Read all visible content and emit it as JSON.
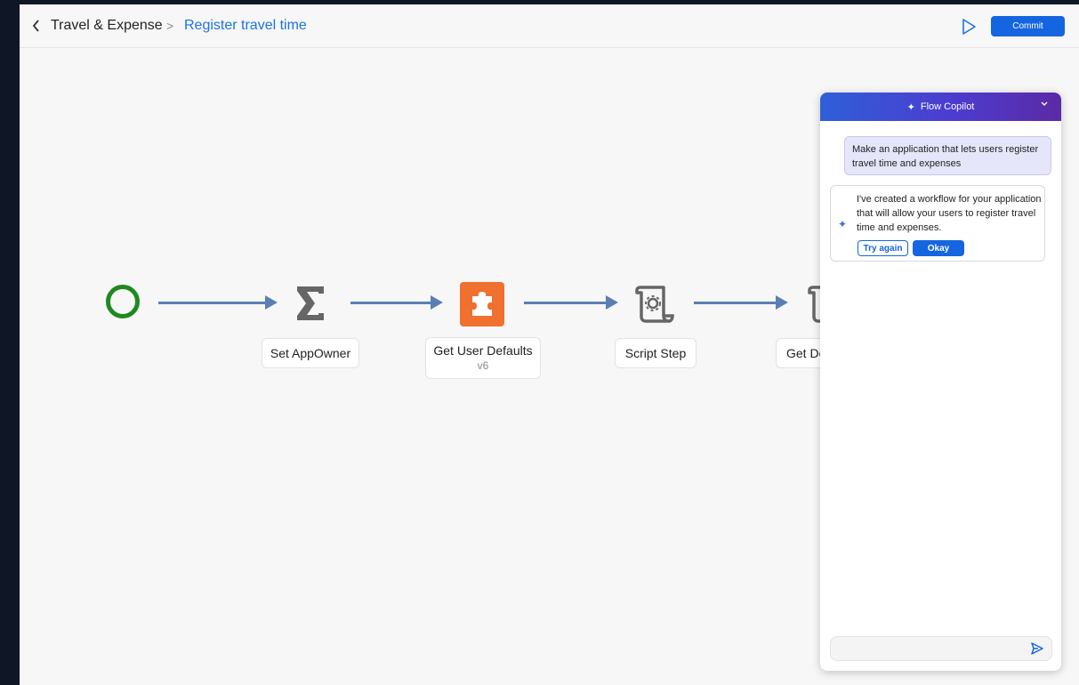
{
  "topbar": {
    "back_icon": "chevron-left-icon",
    "breadcrumb_root": "Travel & Expense",
    "breadcrumb_separator": ">",
    "breadcrumb_current": "Register travel time",
    "run_icon": "play-icon",
    "commit_label": "Commit"
  },
  "flow": {
    "nodes": [
      {
        "label": "Set AppOwner",
        "icon": "sigma-icon"
      },
      {
        "label": "Get User Defaults",
        "version": "v6",
        "icon": "puzzle-icon"
      },
      {
        "label": "Script Step",
        "icon": "script-icon"
      },
      {
        "label": "Get De",
        "icon": "script-icon"
      }
    ]
  },
  "copilot": {
    "title": "Flow Copilot",
    "collapse_icon": "chevron-down-icon",
    "user_message": "Make an application that lets users register travel time and expenses",
    "bot_message": "I've created a workflow for your application that will allow your users to register travel time and expenses.",
    "try_again_label": "Try again",
    "okay_label": "Okay",
    "input_value": "",
    "send_icon": "send-icon"
  },
  "colors": {
    "accent": "#1565e0",
    "link": "#1a73e8",
    "start_node": "#1e8a1e",
    "connector": "#5b7fb5",
    "puzzle_tile": "#f07030",
    "icon_gray": "#666666"
  }
}
